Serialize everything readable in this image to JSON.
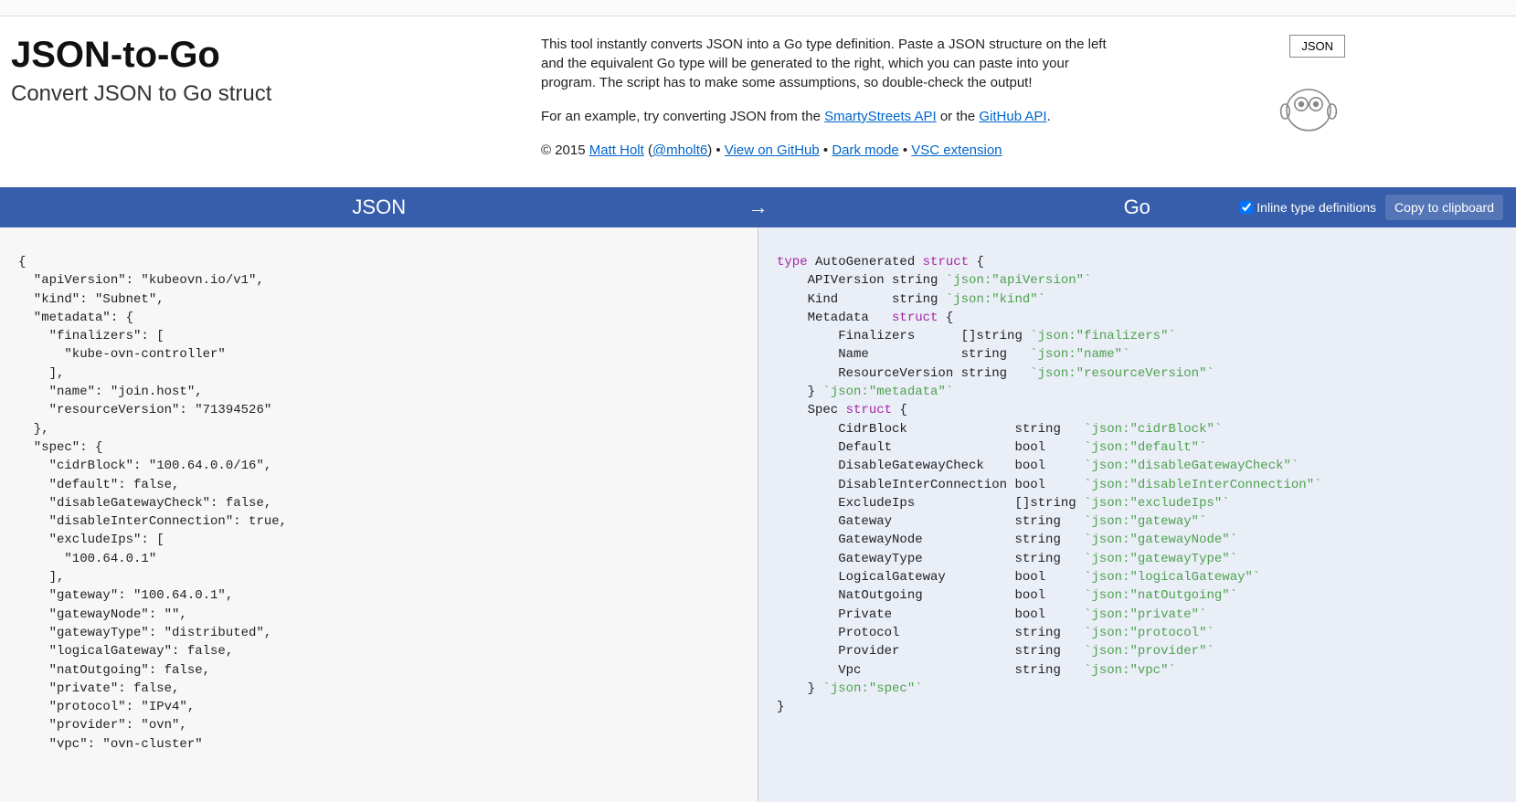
{
  "header": {
    "title": "JSON-to-Go",
    "subtitle": "Convert JSON to Go struct",
    "desc1": "This tool instantly converts JSON into a Go type definition. Paste a JSON structure on the left and the equivalent Go type will be generated to the right, which you can paste into your program. The script has to make some assumptions, so double-check the output!",
    "desc2_pre": "For an example, try converting JSON from the ",
    "desc2_link1": "SmartyStreets API",
    "desc2_mid": " or the ",
    "desc2_link2": "GitHub API",
    "desc2_post": ".",
    "credit_pre": "© 2015 ",
    "credit_name": "Matt Holt",
    "credit_paren_open": " (",
    "credit_handle": "@mholt6",
    "credit_paren_close": ") • ",
    "link_github": "View on GitHub",
    "sep1": " • ",
    "link_dark": "Dark mode",
    "sep2": " • ",
    "link_vsc": "VSC extension",
    "json_btn": "JSON"
  },
  "band": {
    "left": "JSON",
    "arrow": "→",
    "right": "Go",
    "inline_label": "Inline type definitions",
    "copy": "Copy to clipboard"
  },
  "json_input": "{\n  \"apiVersion\": \"kubeovn.io/v1\",\n  \"kind\": \"Subnet\",\n  \"metadata\": {\n    \"finalizers\": [\n      \"kube-ovn-controller\"\n    ],\n    \"name\": \"join.host\",\n    \"resourceVersion\": \"71394526\"\n  },\n  \"spec\": {\n    \"cidrBlock\": \"100.64.0.0/16\",\n    \"default\": false,\n    \"disableGatewayCheck\": false,\n    \"disableInterConnection\": true,\n    \"excludeIps\": [\n      \"100.64.0.1\"\n    ],\n    \"gateway\": \"100.64.0.1\",\n    \"gatewayNode\": \"\",\n    \"gatewayType\": \"distributed\",\n    \"logicalGateway\": false,\n    \"natOutgoing\": false,\n    \"private\": false,\n    \"protocol\": \"IPv4\",\n    \"provider\": \"ovn\",\n    \"vpc\": \"ovn-cluster\"",
  "go_output": {
    "lines": [
      {
        "t": "type ",
        "k": "kw",
        "rest": "AutoGenerated ",
        "k2": "struct",
        "tail": " {"
      },
      {
        "plain": "    APIVersion string ",
        "tag": "`json:\"apiVersion\"`"
      },
      {
        "plain": "    Kind       string ",
        "tag": "`json:\"kind\"`"
      },
      {
        "plain": "    Metadata   ",
        "k2": "struct",
        "tail": " {"
      },
      {
        "plain": "        Finalizers      []string ",
        "tag": "`json:\"finalizers\"`"
      },
      {
        "plain": "        Name            string   ",
        "tag": "`json:\"name\"`"
      },
      {
        "plain": "        ResourceVersion string   ",
        "tag": "`json:\"resourceVersion\"`"
      },
      {
        "plain": "    } ",
        "tag": "`json:\"metadata\"`"
      },
      {
        "plain": "    Spec ",
        "k2": "struct",
        "tail": " {"
      },
      {
        "plain": "        CidrBlock              string   ",
        "tag": "`json:\"cidrBlock\"`"
      },
      {
        "plain": "        Default                bool     ",
        "tag": "`json:\"default\"`"
      },
      {
        "plain": "        DisableGatewayCheck    bool     ",
        "tag": "`json:\"disableGatewayCheck\"`"
      },
      {
        "plain": "        DisableInterConnection bool     ",
        "tag": "`json:\"disableInterConnection\"`"
      },
      {
        "plain": "        ExcludeIps             []string ",
        "tag": "`json:\"excludeIps\"`"
      },
      {
        "plain": "        Gateway                string   ",
        "tag": "`json:\"gateway\"`"
      },
      {
        "plain": "        GatewayNode            string   ",
        "tag": "`json:\"gatewayNode\"`"
      },
      {
        "plain": "        GatewayType            string   ",
        "tag": "`json:\"gatewayType\"`"
      },
      {
        "plain": "        LogicalGateway         bool     ",
        "tag": "`json:\"logicalGateway\"`"
      },
      {
        "plain": "        NatOutgoing            bool     ",
        "tag": "`json:\"natOutgoing\"`"
      },
      {
        "plain": "        Private                bool     ",
        "tag": "`json:\"private\"`"
      },
      {
        "plain": "        Protocol               string   ",
        "tag": "`json:\"protocol\"`"
      },
      {
        "plain": "        Provider               string   ",
        "tag": "`json:\"provider\"`"
      },
      {
        "plain": "        Vpc                    string   ",
        "tag": "`json:\"vpc\"`"
      },
      {
        "plain": "    } ",
        "tag": "`json:\"spec\"`"
      },
      {
        "plain": "}"
      }
    ]
  }
}
